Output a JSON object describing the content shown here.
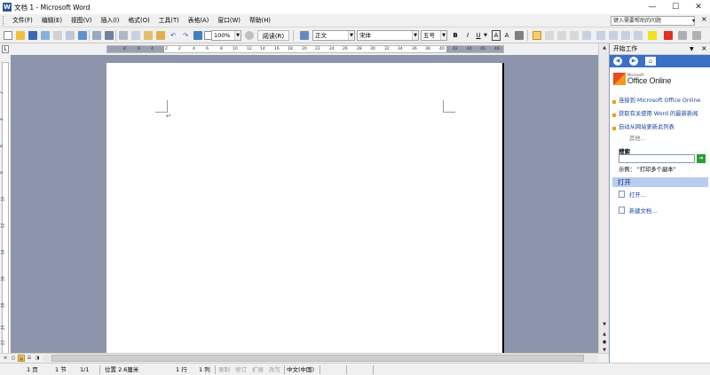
{
  "window": {
    "title": "文档 1 - Microsoft Word",
    "minimize": "—",
    "maximize": "☐",
    "close": "✕"
  },
  "menu": {
    "items": [
      "文件(F)",
      "编辑(E)",
      "视图(V)",
      "插入(I)",
      "格式(O)",
      "工具(T)",
      "表格(A)",
      "窗口(W)",
      "帮助(H)"
    ],
    "help_placeholder": "键入需要帮助的问题",
    "close": "×"
  },
  "toolbar": {
    "zoom": "100%",
    "read_label": "阅读(R)",
    "style": "正文",
    "font": "宋体",
    "size": "五号",
    "bold": "B",
    "italic": "I",
    "underline": "U",
    "char_border": "A",
    "char_scale": "A"
  },
  "ruler": {
    "h_numbers": [
      "8",
      "6",
      "4",
      "2",
      "2",
      "4",
      "6",
      "8",
      "10",
      "12",
      "14",
      "16",
      "18",
      "20",
      "22",
      "24",
      "26",
      "28",
      "30",
      "32",
      "34",
      "36",
      "38",
      "40",
      "42",
      "44",
      "46",
      "48"
    ],
    "v_numbers": [
      "2",
      "4",
      "6",
      "8",
      "10",
      "12",
      "14",
      "16",
      "18",
      "20",
      "22"
    ],
    "corner": "L"
  },
  "document": {
    "paragraph_mark": "↵"
  },
  "status": {
    "page": "1 页",
    "section": "1 节",
    "pages": "1/1",
    "position": "位置 2.6厘米",
    "line": "1 行",
    "column": "1 列",
    "rec": "录制",
    "trk": "修订",
    "ext": "扩展",
    "ovr": "改写",
    "language": "中文(中国)"
  },
  "taskpane": {
    "title": "开始工作",
    "close": "×",
    "dropdown": "▼",
    "logo_small": "Microsoft",
    "logo_text": "Office Online",
    "links": [
      "连接到 Microsoft Office Online",
      "获取有关使用 Word 的最新新闻",
      "自动从网站更新此列表"
    ],
    "more": "其他...",
    "search_label": "搜索",
    "search_go": "➔",
    "example": "示例：  \"打印多个副本\"",
    "open_section": "打开",
    "open_link": "打开...",
    "new_doc_link": "新建文档..."
  }
}
